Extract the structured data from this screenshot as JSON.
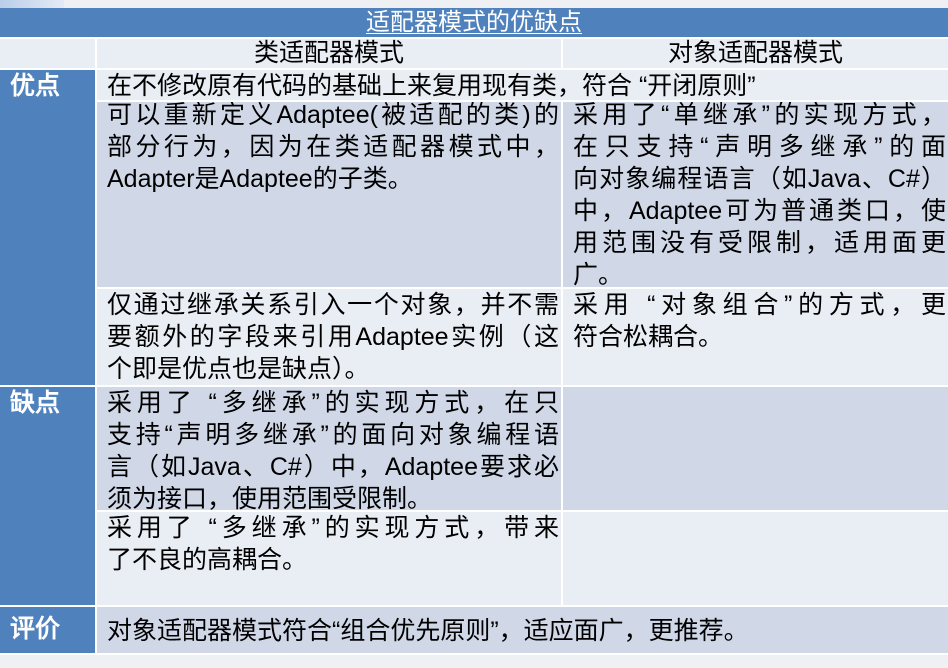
{
  "slide": {
    "title": "适配器模式的优缺点"
  },
  "header": {
    "class_adapter": "类适配器模式",
    "object_adapter": "对象适配器模式"
  },
  "pros": {
    "label": "优点",
    "shared": "在不修改原有代码的基础上来复用现有类，符合 “开闭原则”",
    "rows": [
      {
        "class_adapter": [
          "可以重新定义Adaptee(被适配的类)的",
          "部分行为，因为在类适配器模式中，",
          "Adapter是Adaptee的子类。"
        ],
        "object_adapter": [
          "采用了“单继承”的实现方式，",
          "在只支持“声明多继承”的面",
          "向对象编程语言（如Java、C#）",
          "中，Adaptee可为普通类口，使",
          "用范围没有受限制，适用面更",
          "广。"
        ]
      },
      {
        "class_adapter": [
          "仅通过继承关系引入一个对象，并不需",
          "要额外的字段来引用Adaptee实例（这",
          "个即是优点也是缺点）。"
        ],
        "object_adapter": [
          "采用 “对象组合”的方式，更",
          "符合松耦合。"
        ]
      }
    ]
  },
  "cons": {
    "label": "缺点",
    "rows": [
      {
        "class_adapter": [
          "采用了 “多继承”的实现方式，在只",
          "支持“声明多继承”的面向对象编程语",
          "言（如Java、C#）中，Adaptee要求必",
          "须为接口，使用范围受限制。"
        ],
        "object_adapter": []
      },
      {
        "class_adapter": [
          "采用了 “多继承”的实现方式，带来",
          "了不良的高耦合。"
        ],
        "object_adapter": []
      }
    ]
  },
  "evaluation": {
    "label": "评价",
    "text": "对象适配器模式符合“组合优先原则”，适应面广，更推荐。"
  },
  "colors": {
    "title_bar": "#4f81bd",
    "label_column": "#4f81bd",
    "row_dark": "#d0d8e8",
    "row_light": "#e9edf4",
    "header_row": "#e9edf4",
    "grid_line": "#ffffff",
    "page_background": "#eef0f3"
  }
}
